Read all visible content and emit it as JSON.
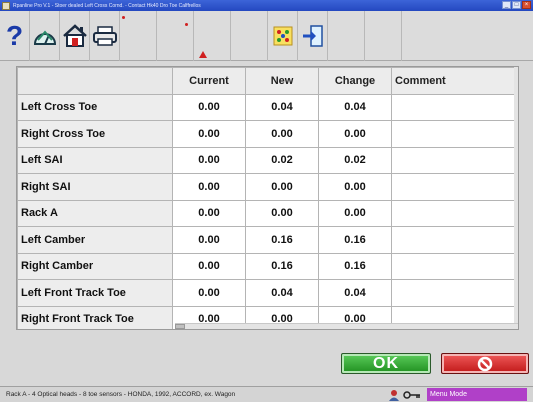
{
  "window": {
    "title": "Rpanline Pro V.1 - Stoer dealed Left Cross Cornd. - Contact Hk40 Dro Toe Calffrellos"
  },
  "toolbar": {
    "help_label": "?",
    "buttons": [
      "help",
      "specifications",
      "home",
      "print",
      "blank-1",
      "blank-2",
      "blank-3",
      "blank-4",
      "adjust",
      "exit-to-next",
      "blank-5",
      "blank-6"
    ]
  },
  "table": {
    "headers": [
      "",
      "Current",
      "New",
      "Change",
      "Comment"
    ],
    "rows": [
      {
        "label": "Left Cross Toe",
        "current": "0.00",
        "new": "0.04",
        "change": "0.04",
        "comment": ""
      },
      {
        "label": "Right Cross Toe",
        "current": "0.00",
        "new": "0.00",
        "change": "0.00",
        "comment": ""
      },
      {
        "label": "Left SAI",
        "current": "0.00",
        "new": "0.02",
        "change": "0.02",
        "comment": ""
      },
      {
        "label": "Right SAI",
        "current": "0.00",
        "new": "0.00",
        "change": "0.00",
        "comment": ""
      },
      {
        "label": "Rack A",
        "current": "0.00",
        "new": "0.00",
        "change": "0.00",
        "comment": ""
      },
      {
        "label": "Left Camber",
        "current": "0.00",
        "new": "0.16",
        "change": "0.16",
        "comment": ""
      },
      {
        "label": "Right Camber",
        "current": "0.00",
        "new": "0.16",
        "change": "0.16",
        "comment": ""
      },
      {
        "label": "Left Front Track Toe",
        "current": "0.00",
        "new": "0.04",
        "change": "0.04",
        "comment": ""
      },
      {
        "label": "Right Front Track Toe",
        "current": "0.00",
        "new": "0.00",
        "change": "0.00",
        "comment": ""
      }
    ]
  },
  "dialog": {
    "ok_label": "OK"
  },
  "status": {
    "text": "Rack A - 4 Optical heads - 8 toe sensors - HONDA, 1992, ACCORD, ex. Wagon",
    "mode": "Menu Mode"
  },
  "colors": {
    "ok_green": "#2fa32f",
    "cancel_red": "#d42020",
    "menu_mode_purple": "#b040c8",
    "titlebar_blue": "#2a50c8"
  }
}
